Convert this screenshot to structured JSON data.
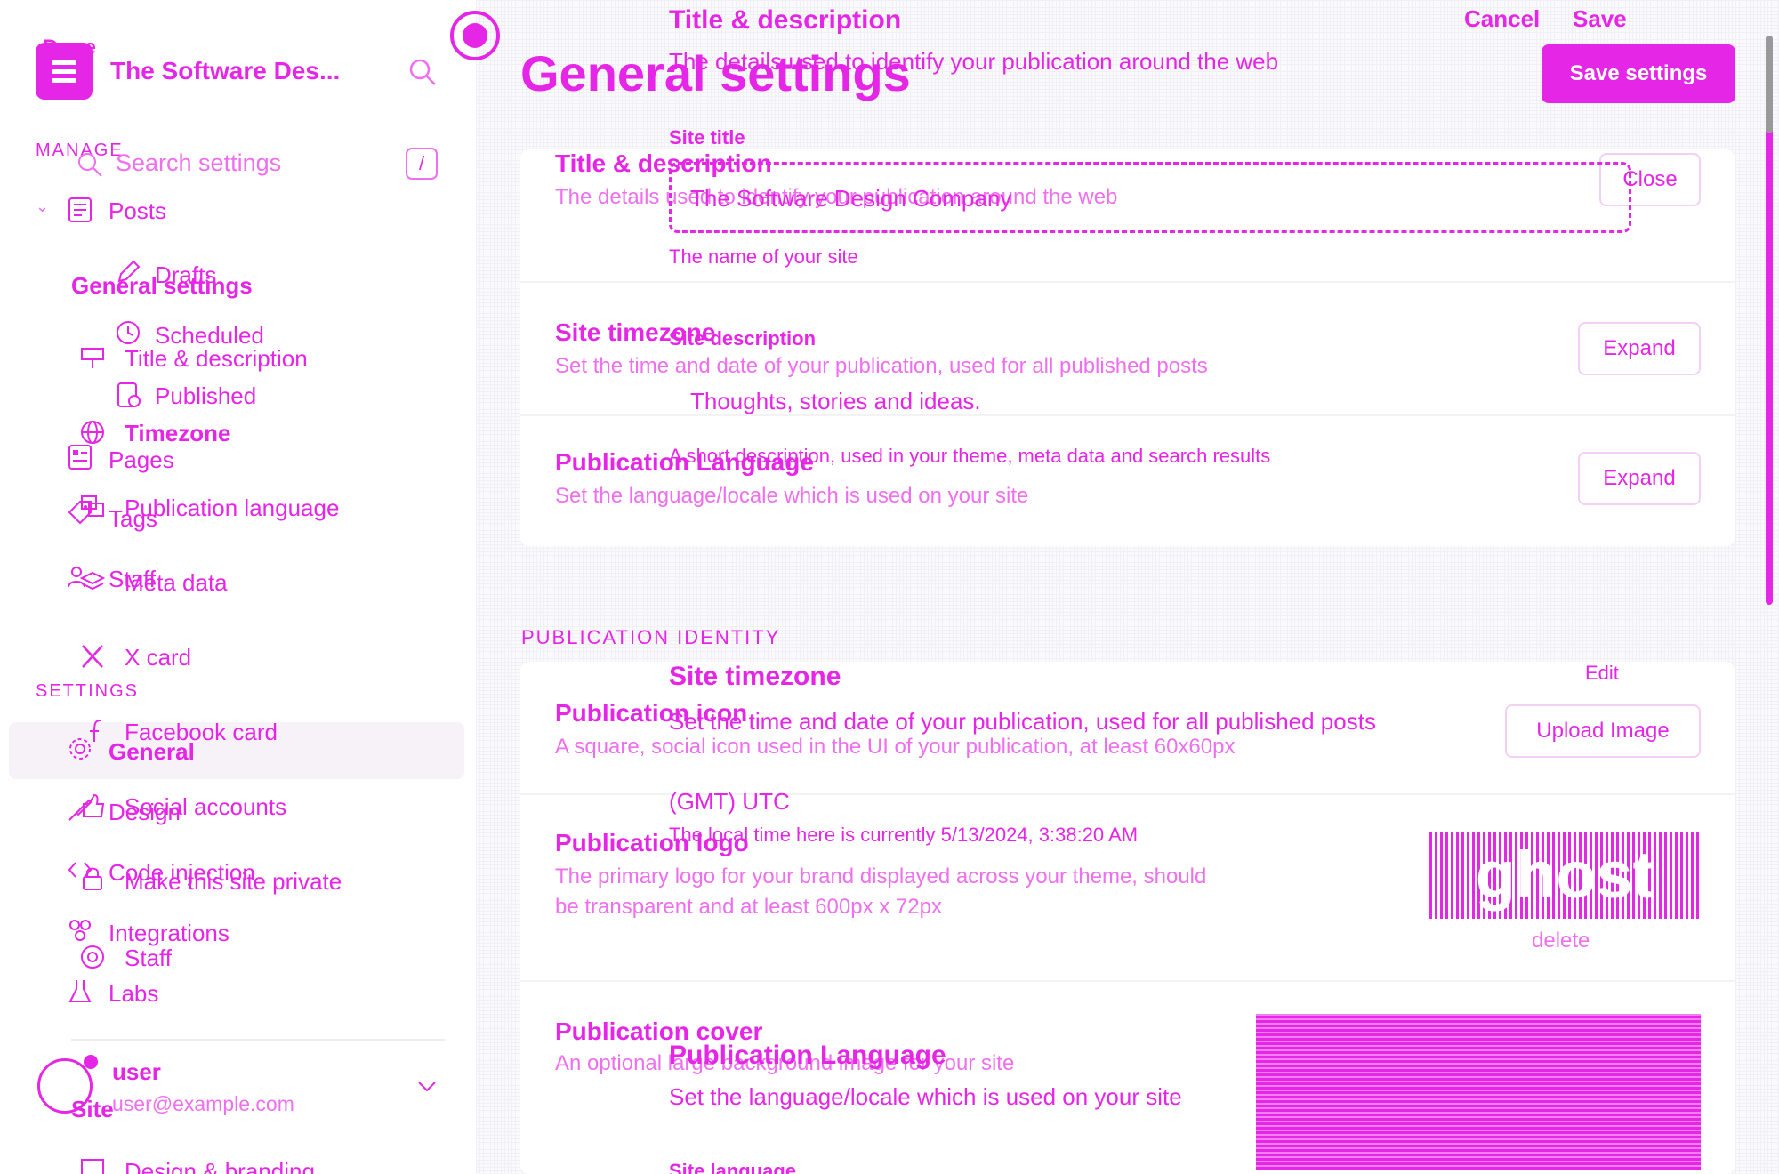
{
  "colors": {
    "accent": "#e626e6",
    "muted": "#ef6fef",
    "panel": "#fafafc"
  },
  "header": {
    "done_label": "Done",
    "site_name": "The Software Des...",
    "title": "General settings",
    "save_button": "Save settings"
  },
  "search": {
    "placeholder": "Search settings",
    "shortcut": "/"
  },
  "sidebar": {
    "manage_label": "MANAGE",
    "settings_label": "SETTINGS",
    "site_label": "Site",
    "manage_items": [
      {
        "label": "Posts",
        "icon": "posts-icon"
      },
      {
        "label": "Drafts",
        "icon": "pencil-icon"
      },
      {
        "label": "Scheduled",
        "icon": "clock-icon"
      },
      {
        "label": "Published",
        "icon": "published-icon"
      },
      {
        "label": "Pages",
        "icon": "pages-icon"
      },
      {
        "label": "Tags",
        "icon": "tag-icon"
      },
      {
        "label": "Staff",
        "icon": "staff-icon"
      }
    ],
    "settings_items": [
      {
        "label": "General",
        "icon": "gear-icon"
      },
      {
        "label": "Design",
        "icon": "brush-icon"
      },
      {
        "label": "Code injection",
        "icon": "code-icon"
      },
      {
        "label": "Integrations",
        "icon": "integrations-icon"
      },
      {
        "label": "Labs",
        "icon": "flask-icon"
      }
    ],
    "general_section": {
      "heading": "General settings",
      "items": [
        {
          "label": "Title & description",
          "icon": "desk-icon"
        },
        {
          "label": "Timezone",
          "icon": "globe-icon"
        },
        {
          "label": "Publication language",
          "icon": "language-icon"
        },
        {
          "label": "Meta data",
          "icon": "layers-icon"
        },
        {
          "label": "X card",
          "icon": "x-icon"
        },
        {
          "label": "Facebook card",
          "icon": "facebook-icon"
        },
        {
          "label": "Social accounts",
          "icon": "thumb-icon"
        },
        {
          "label": "Make this site private",
          "icon": "lock-icon"
        },
        {
          "label": "Staff",
          "icon": "staff-icon"
        },
        {
          "label": "Design & branding",
          "icon": "design-icon"
        }
      ]
    },
    "user": {
      "name": "user",
      "email": "user@example.com"
    }
  },
  "main": {
    "rows_group1": [
      {
        "title": "Title & description",
        "desc": "The details used to identify your publication around the web",
        "button": "Close"
      },
      {
        "title": "Site timezone",
        "desc": "Set the time and date of your publication, used for all published posts",
        "button": "Expand"
      },
      {
        "title": "Publication Language",
        "desc": "Set the language/locale which is used on your site",
        "button": "Expand"
      }
    ],
    "identity_heading": "PUBLICATION IDENTITY",
    "rows_group2": [
      {
        "title": "Publication icon",
        "desc": "A square, social icon used in the UI of your publication, at least 60x60px",
        "button": "Upload Image"
      },
      {
        "title": "Publication logo",
        "desc": "The primary logo for your brand displayed across your theme, should",
        "desc2": "be transparent and at least 600px x 72px",
        "logo_text": "ghost",
        "delete": "delete"
      },
      {
        "title": "Publication cover",
        "desc": "An optional large background image for your site"
      }
    ]
  },
  "overlay": {
    "top_title": "Title & description",
    "top_desc": "The details used to identify your publication around the web",
    "cancel": "Cancel",
    "save": "Save",
    "site_title_label": "Site title",
    "site_title_value": "The Software Design Company",
    "site_title_hint": "The name of your site",
    "site_desc_label": "Site description",
    "site_desc_value": "Thoughts, stories and ideas.",
    "site_desc_hint": "A short description, used in your theme, meta data and search results",
    "tz_title": "Site timezone",
    "tz_edit": "Edit",
    "tz_desc": "Set the time and date of your publication, used for all published posts",
    "tz_value": "(GMT) UTC",
    "tz_local": "The local time here is currently 5/13/2024, 3:38:20 AM",
    "lang_title": "Publication Language",
    "lang_desc": "Set the language/locale which is used on your site",
    "lang_label": "Site language"
  }
}
